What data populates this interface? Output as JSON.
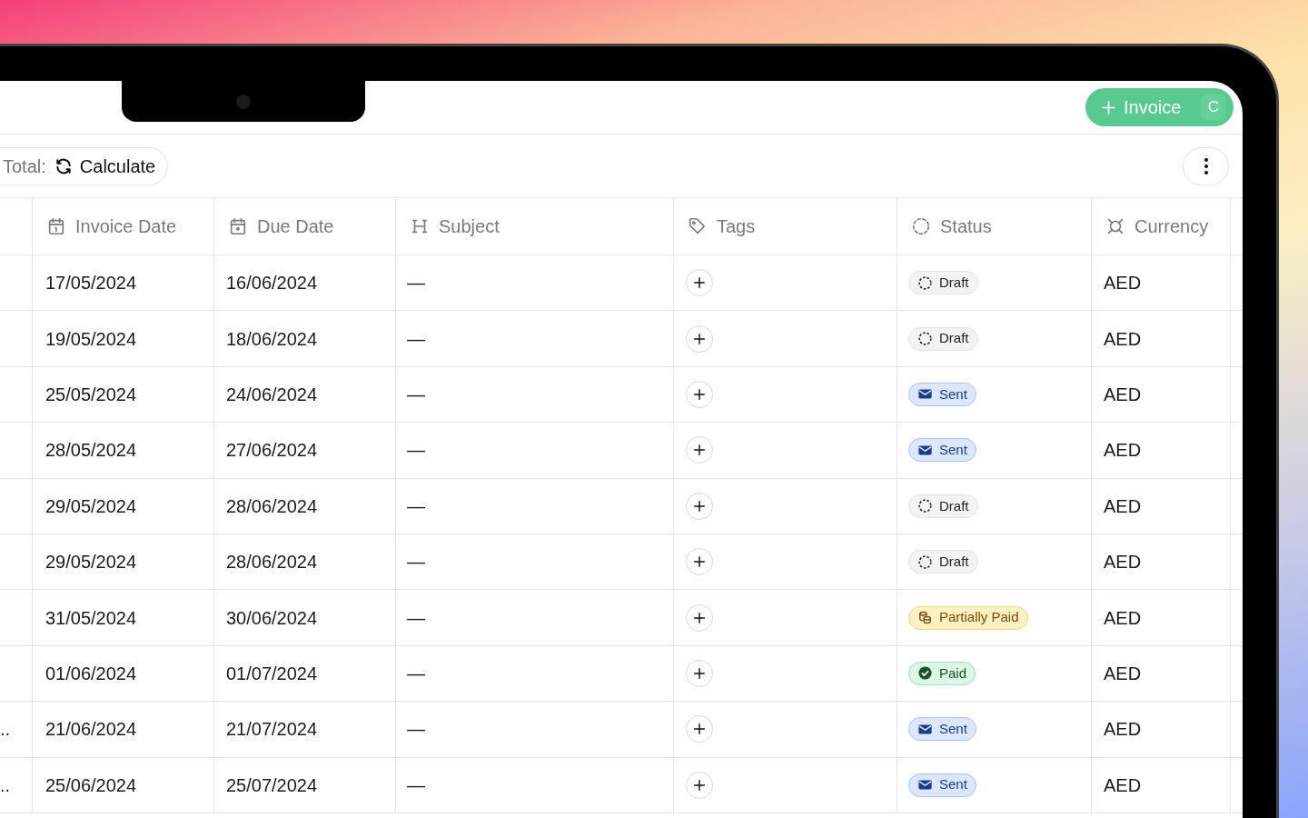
{
  "header": {
    "new_button": {
      "label": "Invoice",
      "shortcut": "C"
    }
  },
  "toolbar": {
    "total_label": "Total:",
    "calculate_button": "Calculate"
  },
  "table": {
    "columns": [
      {
        "label": "Invoice Date",
        "kind": "date"
      },
      {
        "label": "Due Date",
        "kind": "due"
      },
      {
        "label": "Subject",
        "kind": "heading"
      },
      {
        "label": "Tags",
        "kind": "tag"
      },
      {
        "label": "Status",
        "kind": "status"
      },
      {
        "label": "Currency",
        "kind": "currency"
      }
    ],
    "rows": [
      {
        "invoice_date": "17/05/2024",
        "due_date": "16/06/2024",
        "subject": "—",
        "status": {
          "label": "Draft",
          "kind": "draft"
        },
        "currency": "AED"
      },
      {
        "invoice_date": "19/05/2024",
        "due_date": "18/06/2024",
        "subject": "—",
        "status": {
          "label": "Draft",
          "kind": "draft"
        },
        "currency": "AED"
      },
      {
        "invoice_date": "25/05/2024",
        "due_date": "24/06/2024",
        "subject": "—",
        "status": {
          "label": "Sent",
          "kind": "sent"
        },
        "currency": "AED"
      },
      {
        "invoice_date": "28/05/2024",
        "due_date": "27/06/2024",
        "subject": "—",
        "status": {
          "label": "Sent",
          "kind": "sent"
        },
        "currency": "AED"
      },
      {
        "invoice_date": "29/05/2024",
        "due_date": "28/06/2024",
        "subject": "—",
        "status": {
          "label": "Draft",
          "kind": "draft"
        },
        "currency": "AED"
      },
      {
        "invoice_date": "29/05/2024",
        "due_date": "28/06/2024",
        "subject": "—",
        "status": {
          "label": "Draft",
          "kind": "draft"
        },
        "currency": "AED"
      },
      {
        "invoice_date": "31/05/2024",
        "due_date": "30/06/2024",
        "subject": "—",
        "status": {
          "label": "Partially Paid",
          "kind": "partial"
        },
        "currency": "AED"
      },
      {
        "invoice_date": "01/06/2024",
        "due_date": "01/07/2024",
        "subject": "—",
        "status": {
          "label": "Paid",
          "kind": "paid"
        },
        "currency": "AED"
      },
      {
        "column_1": "..",
        "invoice_date": "21/06/2024",
        "due_date": "21/07/2024",
        "subject": "—",
        "status": {
          "label": "Sent",
          "kind": "sent"
        },
        "currency": "AED"
      },
      {
        "column_1": "..",
        "invoice_date": "25/06/2024",
        "due_date": "25/07/2024",
        "subject": "—",
        "status": {
          "label": "Sent",
          "kind": "sent"
        },
        "currency": "AED"
      }
    ]
  }
}
